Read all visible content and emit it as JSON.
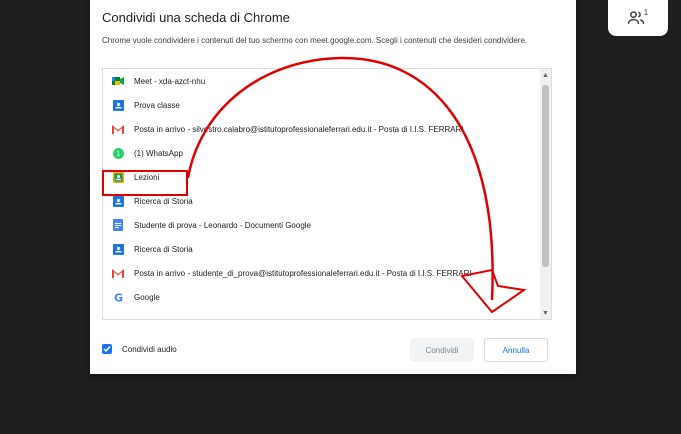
{
  "dialog": {
    "title": "Condividi una scheda di Chrome",
    "description": "Chrome vuole condividere i contenuti del tuo schermo con meet.google.com. Scegli i contenuti che desideri condividere.",
    "tabs": [
      {
        "label": "Meet - xda-azct-nhu",
        "icon": "meet-icon",
        "color": "#00832d"
      },
      {
        "label": "Prova classe",
        "icon": "classroom-icon",
        "color": "#1a73e8"
      },
      {
        "label": "Posta in arrivo - silvestro.calabro@istitutoprofessionaleferrari.edu.it - Posta di I.I.S. FERRARI",
        "icon": "gmail-icon",
        "color": "#ea4335"
      },
      {
        "label": "(1) WhatsApp",
        "icon": "whatsapp-icon",
        "color": "#25d366"
      },
      {
        "label": "Lezioni",
        "icon": "classroom-icon",
        "color": "#f9ab00"
      },
      {
        "label": "Ricerca di Storia",
        "icon": "classroom-icon",
        "color": "#1a73e8"
      },
      {
        "label": "Studente di prova - Leonardo - Documenti Google",
        "icon": "docs-icon",
        "color": "#4285f4"
      },
      {
        "label": "Ricerca di Storia",
        "icon": "classroom-icon",
        "color": "#1a73e8"
      },
      {
        "label": "Posta in arrivo - studente_di_prova@istitutoprofessionaleferrari.edu.it - Posta di I.I.S. FERRARI",
        "icon": "gmail-icon",
        "color": "#ea4335"
      },
      {
        "label": "Google",
        "icon": "google-icon",
        "color": "#4285f4"
      }
    ],
    "audio_label": "Condividi audio",
    "share_label": "Condividi",
    "cancel_label": "Annulla"
  },
  "meet": {
    "participants_count": "1"
  },
  "colors": {
    "accent": "#1a73e8",
    "annotation": "#e10000"
  }
}
